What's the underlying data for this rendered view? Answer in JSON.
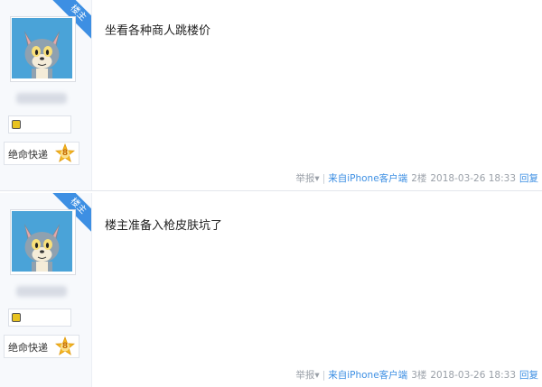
{
  "posts": [
    {
      "author": {
        "badge": "楼主",
        "title": "绝命快递",
        "level": "8"
      },
      "content": "坐看各种商人跳楼价",
      "meta": {
        "report": "举报▾",
        "source": "来自iPhone客户端",
        "floor": "2楼",
        "time": "2018-03-26 18:33",
        "reply": "回复"
      }
    },
    {
      "author": {
        "badge": "楼主",
        "title": "绝命快递",
        "level": "8"
      },
      "content": "楼主准备入枪皮肤坑了",
      "meta": {
        "report": "举报▾",
        "source": "来自iPhone客户端",
        "floor": "3楼",
        "time": "2018-03-26 18:33",
        "reply": "回复"
      }
    }
  ],
  "colors": {
    "accent": "#3d8fe3",
    "sidebar": "#f7f9fc",
    "avatar_bg": "#4aa3d8",
    "gem": "#e8c320",
    "star": "#f5b820"
  },
  "icons": {
    "avatar": "tom-cat-avatar",
    "badge": "yellow-gem-icon",
    "level": "star-level-icon"
  }
}
